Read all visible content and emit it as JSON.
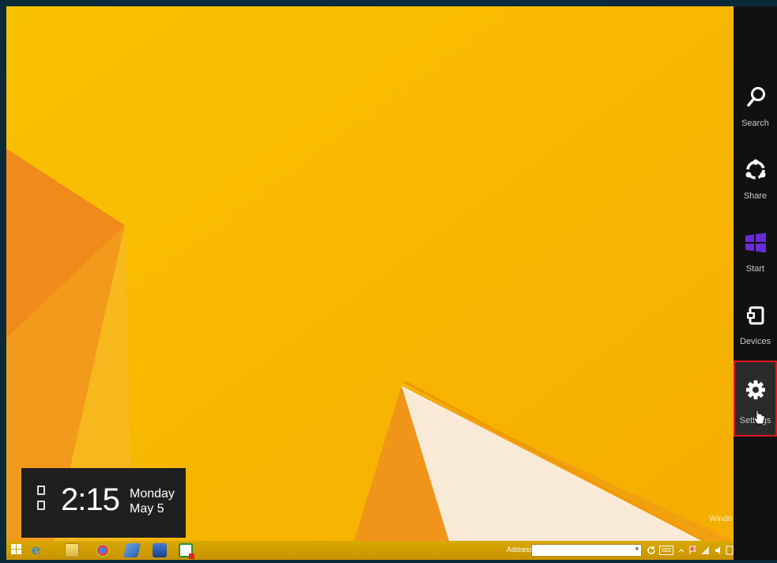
{
  "desktop": {
    "watermark": "Windo"
  },
  "clock": {
    "time": "2:15",
    "day": "Monday",
    "date": "May 5"
  },
  "taskbar": {
    "address_label": "Address",
    "address_value": "",
    "icons": [
      "windows-start-icon",
      "internet-explorer-icon",
      "file-explorer-icon",
      "chrome-icon",
      "app-icon",
      "app-icon",
      "app-icon"
    ]
  },
  "charms": {
    "items": [
      {
        "label": "Search",
        "icon": "search-icon"
      },
      {
        "label": "Share",
        "icon": "share-icon"
      },
      {
        "label": "Start",
        "icon": "windows-logo-icon"
      },
      {
        "label": "Devices",
        "icon": "devices-icon"
      },
      {
        "label": "Settings",
        "icon": "gear-icon",
        "highlighted": true
      }
    ],
    "highlight_color": "#e3161e",
    "start_color": "#6a2bd8"
  }
}
